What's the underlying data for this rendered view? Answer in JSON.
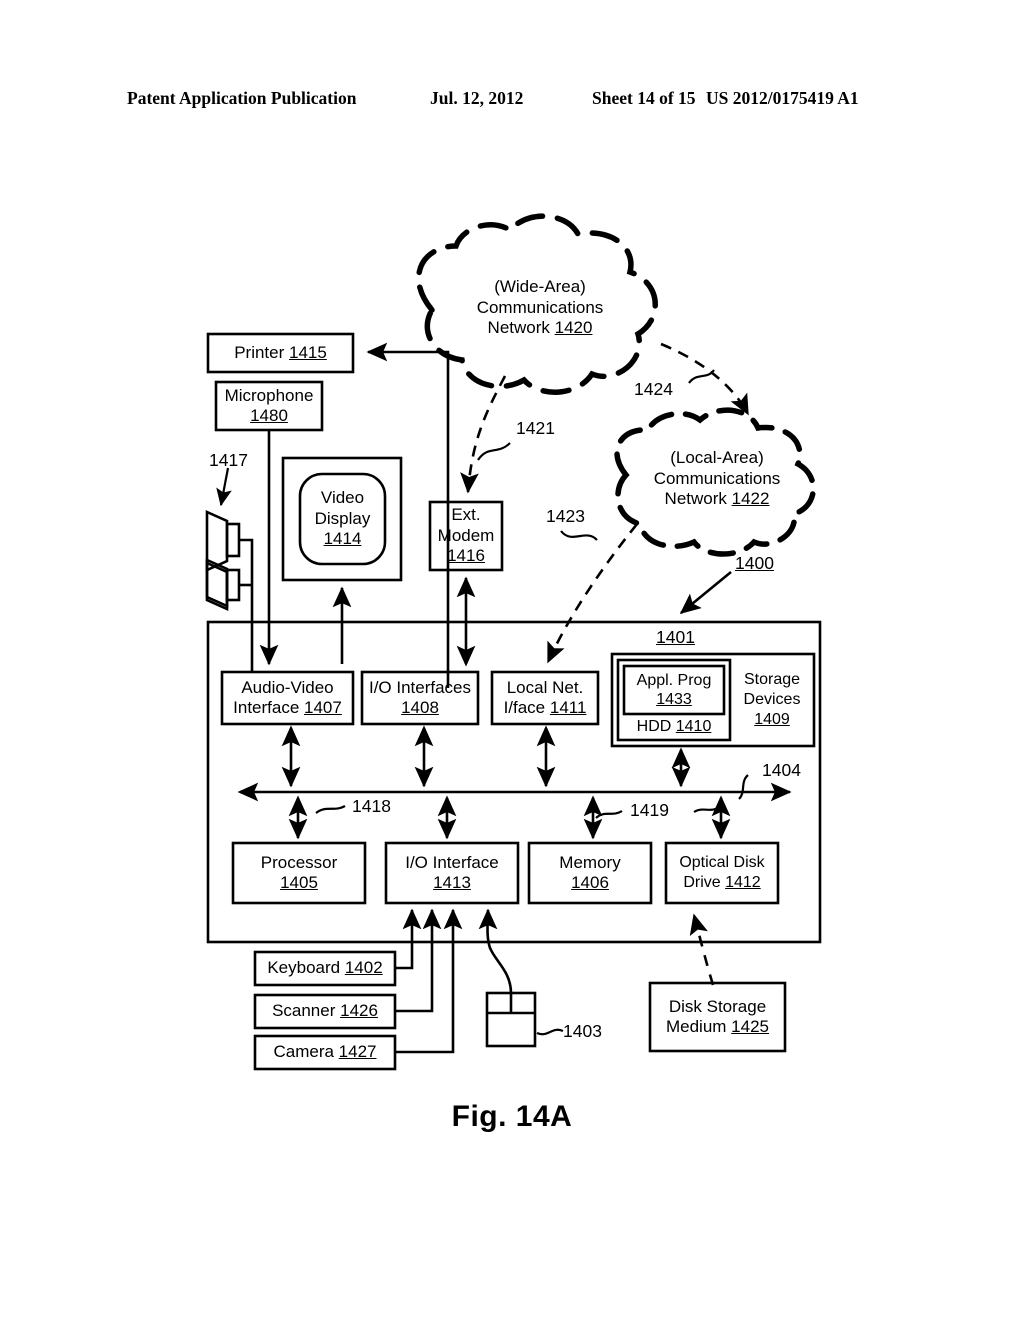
{
  "header": {
    "publication": "Patent Application Publication",
    "date": "Jul. 12, 2012",
    "sheet": "Sheet 14 of 15",
    "number": "US 2012/0175419 A1"
  },
  "figure": {
    "caption": "Fig. 14A"
  },
  "clouds": [
    {
      "name": "wide-area-network",
      "line1": "(Wide-Area)",
      "line2": "Communications",
      "line3": "Network ",
      "ref": "1420"
    },
    {
      "name": "local-area-network",
      "line1": "(Local-Area)",
      "line2": "Communications",
      "line3": "Network ",
      "ref": "1422"
    }
  ],
  "boxes": {
    "printer": {
      "label": "Printer ",
      "ref": "1415"
    },
    "microphone": {
      "label": "Microphone",
      "ref": "1480"
    },
    "video_display": {
      "label1": "Video",
      "label2": "Display",
      "ref": "1414"
    },
    "ext_modem": {
      "label1": "Ext.",
      "label2": "Modem",
      "ref": "1416"
    },
    "av_interface": {
      "label1": "Audio-Video",
      "label2": "Interface ",
      "ref": "1407"
    },
    "io_interfaces": {
      "label": "I/O Interfaces",
      "ref": "1408"
    },
    "local_net_iface": {
      "label1": "Local Net.",
      "label2": "I/face ",
      "ref": "1411"
    },
    "storage_devices": {
      "label1": "Storage",
      "label2": "Devices",
      "ref": "1409"
    },
    "hdd": {
      "label": "HDD ",
      "ref": "1410"
    },
    "appl_prog": {
      "label": "Appl. Prog",
      "ref": "1433"
    },
    "processor": {
      "label": "Processor",
      "ref": "1405"
    },
    "io_interface": {
      "label": "I/O Interface",
      "ref": "1413"
    },
    "memory": {
      "label": "Memory",
      "ref": "1406"
    },
    "optical_disk": {
      "label1": "Optical Disk",
      "label2": "Drive ",
      "ref": "1412"
    },
    "keyboard": {
      "label": "Keyboard ",
      "ref": "1402"
    },
    "scanner": {
      "label": "Scanner ",
      "ref": "1426"
    },
    "camera": {
      "label": "Camera ",
      "ref": "1427"
    },
    "disk_storage": {
      "label1": "Disk Storage",
      "label2": "Medium ",
      "ref": "1425"
    }
  },
  "reference_numerals": [
    {
      "name": "computer-system-1400",
      "value": "1400",
      "underlined": true
    },
    {
      "name": "computer-module-1401",
      "value": "1401",
      "underlined": true
    },
    {
      "name": "mouse-1403",
      "value": "1403",
      "underlined": false
    },
    {
      "name": "bus-1404",
      "value": "1404",
      "underlined": false
    },
    {
      "name": "speakers-1417",
      "value": "1417",
      "underlined": false
    },
    {
      "name": "connection-1418",
      "value": "1418",
      "underlined": false
    },
    {
      "name": "connection-1419",
      "value": "1419",
      "underlined": false
    },
    {
      "name": "connection-1421",
      "value": "1421",
      "underlined": false
    },
    {
      "name": "connection-1423",
      "value": "1423",
      "underlined": false
    },
    {
      "name": "connection-1424",
      "value": "1424",
      "underlined": false
    }
  ],
  "colors": {
    "ink": "#000000",
    "paper": "#ffffff"
  }
}
